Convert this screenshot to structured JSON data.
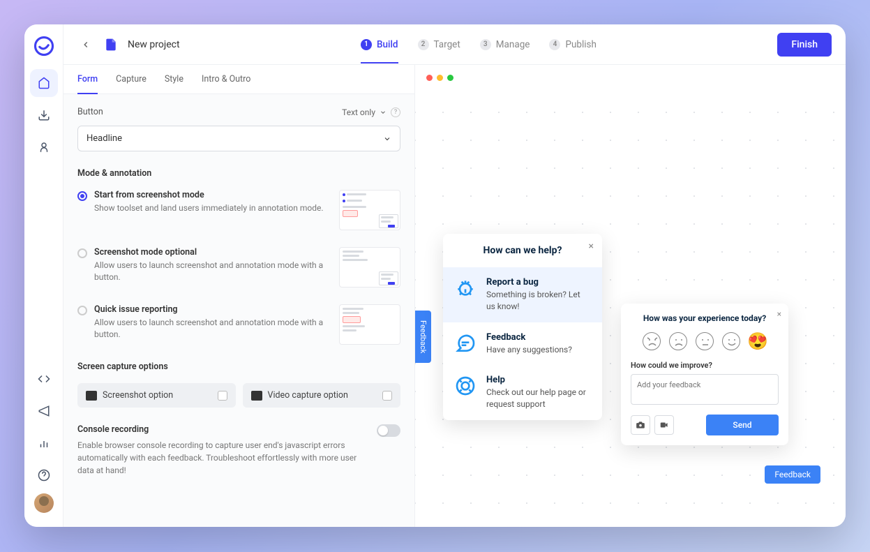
{
  "header": {
    "project_title": "New project",
    "finish_label": "Finish"
  },
  "stepper": {
    "steps": [
      "Build",
      "Target",
      "Manage",
      "Publish"
    ],
    "active_index": 0
  },
  "subtabs": {
    "items": [
      "Form",
      "Capture",
      "Style",
      "Intro & Outro"
    ],
    "active_index": 0
  },
  "form_panel": {
    "button_label": "Button",
    "text_only_label": "Text only",
    "headline_value": "Headline",
    "mode_section_title": "Mode & annotation",
    "modes": [
      {
        "title": "Start from screenshot mode",
        "desc": "Show toolset and land users immediately in annotation mode.",
        "checked": true
      },
      {
        "title": "Screenshot mode optional",
        "desc": "Allow users to launch screenshot and annotation mode with a button.",
        "checked": false
      },
      {
        "title": "Quick issue reporting",
        "desc": "Allow users to launch screenshot and annotation mode with a button.",
        "checked": false
      }
    ],
    "capture_section_title": "Screen capture options",
    "capture_options": {
      "screenshot": "Screenshot option",
      "video": "Video capture option"
    },
    "console": {
      "title": "Console recording",
      "desc": "Enable browser console recording to capture user end's javascript errors automatically with each feedback. Troubleshoot effortlessly with more user data at hand!"
    }
  },
  "preview": {
    "feedback_tab": "Feedback",
    "feedback_badge": "Feedback",
    "help_popup": {
      "title": "How can we help?",
      "items": [
        {
          "title": "Report a bug",
          "desc": "Something is broken? Let us know!"
        },
        {
          "title": "Feedback",
          "desc": "Have any suggestions?"
        },
        {
          "title": "Help",
          "desc": "Check out our help page or request support"
        }
      ]
    },
    "experience_popup": {
      "title": "How was your experience today?",
      "subtitle": "How could we improve?",
      "placeholder": "Add your feedback",
      "send_label": "Send"
    }
  }
}
